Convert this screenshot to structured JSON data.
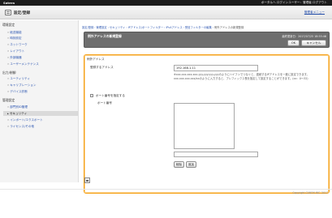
{
  "topbar": {
    "brand": "Satera",
    "links": "ポータルへ  ログインユーザー：管理者  ログアウト"
  },
  "header": {
    "title": "設定/登録",
    "back_link": "管理者メニュー"
  },
  "sidebar": {
    "sections": [
      {
        "label": "環境設定",
        "items": [
          "紙送機能",
          "時刻設定",
          "ネットワーク",
          "レイアウト",
          "外部機器",
          "ユーザーメンテナンス"
        ]
      },
      {
        "label": "出力/制御",
        "items": [
          "ユーティリティ",
          "キャリブレーション",
          "デバイス診断"
        ]
      },
      {
        "label": "管理設定",
        "items": [
          "部門別ID管理",
          "セキュリティ",
          "インポート/エクスポート",
          "ライセンス/その他"
        ]
      }
    ],
    "active_item": "セキュリティ"
  },
  "main": {
    "breadcrumb": "設定/登録 : 管理設定 : セキュリティ : IPアドレス/ポートフィルター : IPv4アドレス : 受信フィルターの編集 : ",
    "breadcrumb_current": "例外アドレスの新規登録",
    "page_name": "例外アドレスの新規登録",
    "last_updated": "最終更新日：2017/07/25 18:55:46",
    "ok_label": "OK",
    "cancel_label": "キャンセル",
    "panel_title": "例外アドレス",
    "address_label": "登録するアドレス",
    "address_value": "192.168.1.11",
    "note": "※xxx.xxx.xxx.xxx-yyy.yyy.yyy.yyyのようにハイフンでつなぐと、連続するIPアドレスを一度に設定できます。xxx.xxx.xxx.xxx/xxのように入力すると、プレフィックス長を指定して設定することができます。(xx：0～32)",
    "port_checkbox_label": "ポート番号を指定する",
    "port_label": "ポート番号",
    "port_input_value": "",
    "delete_label": "削除",
    "add_label": "追加",
    "copyright": "Copyright CANON INC. 2017"
  }
}
